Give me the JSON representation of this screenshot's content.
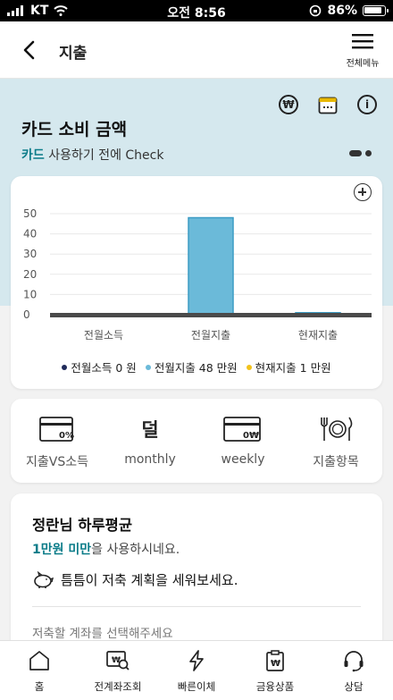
{
  "status_bar": {
    "carrier": "KT",
    "time": "오전 8:56",
    "battery": "86%"
  },
  "header": {
    "title": "지출",
    "menu_label": "전체메뉴"
  },
  "hero": {
    "title": "카드 소비 금액",
    "subtitle_accent": "카드",
    "subtitle_rest": " 사용하기 전에 Check",
    "icons": [
      "won-circle-icon",
      "calendar-icon",
      "info-icon"
    ]
  },
  "chart_data": {
    "type": "bar",
    "categories": [
      "전월소득",
      "전월지출",
      "현재지출"
    ],
    "values": [
      0,
      48,
      1
    ],
    "ylim": [
      0,
      50
    ],
    "yticks": [
      "0",
      "10",
      "20",
      "30",
      "40",
      "50"
    ],
    "grid": true,
    "bar_color": "#6bbad9",
    "legend": [
      {
        "label": "전월소득 0 원",
        "color": "#1f2a5a"
      },
      {
        "label": "전월지출 48 만원",
        "color": "#6bbad9"
      },
      {
        "label": "현재지출 1 만원",
        "color": "#f2c21b"
      }
    ]
  },
  "quick_menu": {
    "items": [
      {
        "label": "지출VS소득",
        "icon": "card-percent-icon",
        "icon_text": "0%"
      },
      {
        "label": "monthly",
        "icon": "text-icon",
        "icon_text": "덜"
      },
      {
        "label": "weekly",
        "icon": "card-won-icon",
        "icon_text": "0₩"
      },
      {
        "label": "지출항목",
        "icon": "dining-icon",
        "icon_text": ""
      }
    ]
  },
  "daily": {
    "title": "정란님 하루평균",
    "subtitle_accent": "1만원 미만",
    "subtitle_rest": "을 사용하시네요.",
    "tip": "틈틈이 저축 계획을 세워보세요.",
    "hint": "저축할 계좌를 선택해주세요"
  },
  "bottom_nav": {
    "items": [
      {
        "label": "홈",
        "icon": "home-icon"
      },
      {
        "label": "전계좌조회",
        "icon": "account-search-icon"
      },
      {
        "label": "빠른이체",
        "icon": "lightning-icon"
      },
      {
        "label": "금융상품",
        "icon": "product-icon"
      },
      {
        "label": "상담",
        "icon": "headset-icon"
      }
    ]
  },
  "colors": {
    "accent": "#0b7c89",
    "hero_bg": "#d5e8ee"
  }
}
